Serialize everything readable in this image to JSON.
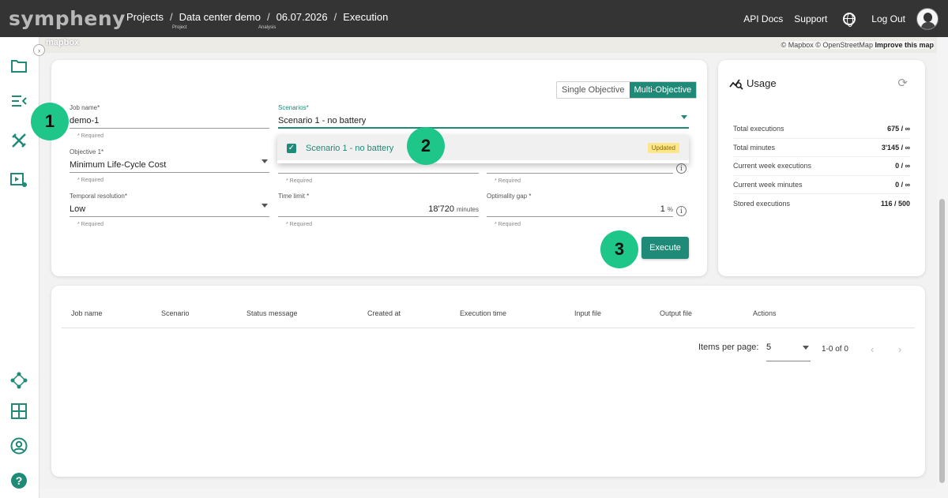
{
  "app": {
    "logo": "sympheny"
  },
  "breadcrumb": {
    "projects": "Projects",
    "project": "Data center demo",
    "project_sub": "Project",
    "analysis": "06.07.2026",
    "analysis_sub": "Analysis",
    "page": "Execution",
    "separator": "/"
  },
  "topnav": {
    "api_docs": "API Docs",
    "support": "Support",
    "logout": "Log Out"
  },
  "map": {
    "logo": "mapbox",
    "attribution": "© Mapbox © OpenStreetMap",
    "improve": "Improve this map"
  },
  "sidebar": {
    "icons": [
      "folder-icon",
      "list-collapse-icon",
      "tools-icon",
      "execution-settings-icon",
      "network-icon",
      "dashboard-icon",
      "account-icon",
      "help-icon"
    ]
  },
  "form": {
    "objective_toggle": {
      "single": "Single Objective",
      "multi": "Multi-Objective",
      "selected": "Multi-Objective"
    },
    "job_name": {
      "label": "Job name*",
      "value": "demo-1",
      "hint": "* Required"
    },
    "scenarios": {
      "label": "Scenarios*",
      "value": "Scenario 1 - no battery"
    },
    "objective1": {
      "label": "Objective 1*",
      "value": "Minimum Life-Cycle Cost",
      "hint": "* Required"
    },
    "objective2": {
      "hint": "* Required"
    },
    "objective3": {
      "hint": "* Required"
    },
    "temporal_resolution": {
      "label": "Temporal resolution*",
      "value": "Low",
      "hint": "* Required"
    },
    "time_limit": {
      "label": "Time limit *",
      "value": "18'720",
      "unit": "minutes",
      "hint": "* Required"
    },
    "optimality_gap": {
      "label": "Optimality gap *",
      "value": "1",
      "unit": "%",
      "hint": "* Required"
    },
    "execute_label": "Execute",
    "dropdown": {
      "option": "Scenario 1 - no battery",
      "badge": "Updated",
      "checked": true
    }
  },
  "steps": [
    "1",
    "2",
    "3"
  ],
  "usage": {
    "title": "Usage",
    "rows": [
      {
        "label": "Total executions",
        "value": "675 / ∞"
      },
      {
        "label": "Total minutes",
        "value": "3'145 / ∞"
      },
      {
        "label": "Current week executions",
        "value": "0 / ∞"
      },
      {
        "label": "Current week minutes",
        "value": "0 / ∞"
      },
      {
        "label": "Stored executions",
        "value": "116 / 500"
      }
    ]
  },
  "table": {
    "columns": [
      "Job name",
      "Scenario",
      "Status message",
      "Created at",
      "Execution time",
      "Input file",
      "Output file",
      "Actions"
    ],
    "items_per_page_label": "Items per page:",
    "items_per_page": "5",
    "range": "1-0 of 0"
  },
  "colors": {
    "accent": "#1f8a78",
    "step": "#1fc68a",
    "topbar": "#343434",
    "badge": "#fde68a"
  }
}
